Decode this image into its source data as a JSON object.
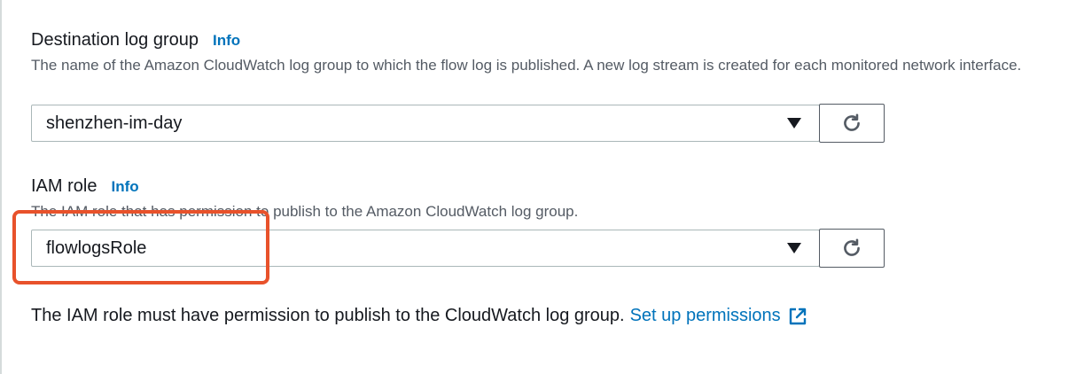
{
  "destination_log_group": {
    "label": "Destination log group",
    "info": "Info",
    "description": "The name of the Amazon CloudWatch log group to which the flow log is published. A new log stream is created for each monitored network interface.",
    "selected_value": "shenzhen-im-day"
  },
  "iam_role": {
    "label": "IAM role",
    "info": "Info",
    "description": "The IAM role that has permission to publish to the Amazon CloudWatch log group.",
    "selected_value": "flowlogsRole"
  },
  "permissions_note": {
    "text": "The IAM role must have permission to publish to the CloudWatch log group.",
    "link_label": "Set up permissions"
  },
  "colors": {
    "link": "#0073bb",
    "highlight": "#e8522b"
  }
}
